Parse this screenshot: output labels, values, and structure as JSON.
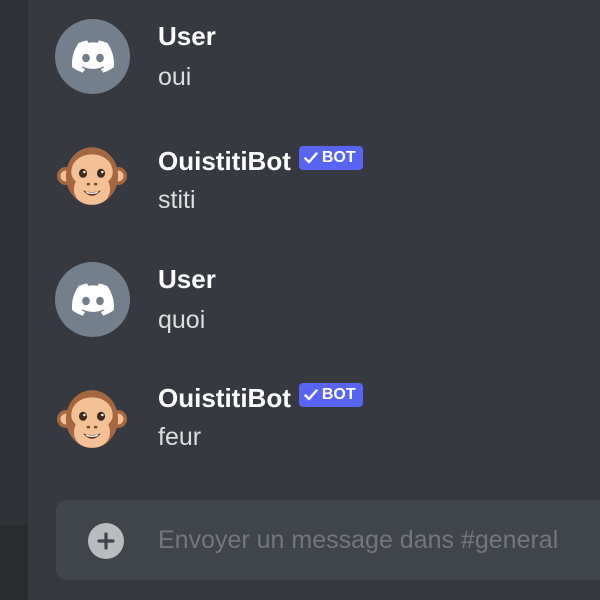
{
  "messages": [
    {
      "author": "User",
      "content": "oui",
      "avatar_icon": "discord-logo-icon",
      "is_bot": false
    },
    {
      "author": "OuistitiBot",
      "content": "stiti",
      "avatar_icon": "monkey-face-icon",
      "is_bot": true,
      "bot_tag": "BOT"
    },
    {
      "author": "User",
      "content": "quoi",
      "avatar_icon": "discord-logo-icon",
      "is_bot": false
    },
    {
      "author": "OuistitiBot",
      "content": "feur",
      "avatar_icon": "monkey-face-icon",
      "is_bot": true,
      "bot_tag": "BOT"
    }
  ],
  "composer": {
    "placeholder": "Envoyer un message dans #general",
    "value": "",
    "attach_icon": "plus-circle-icon"
  },
  "colors": {
    "background": "#36393f",
    "sidebar": "#2f3136",
    "input_background": "#40444b",
    "bot_tag": "#5865f2",
    "discord_avatar": "#747f8d",
    "username": "#ffffff",
    "message_text": "#dcddde",
    "placeholder": "#72767d"
  }
}
